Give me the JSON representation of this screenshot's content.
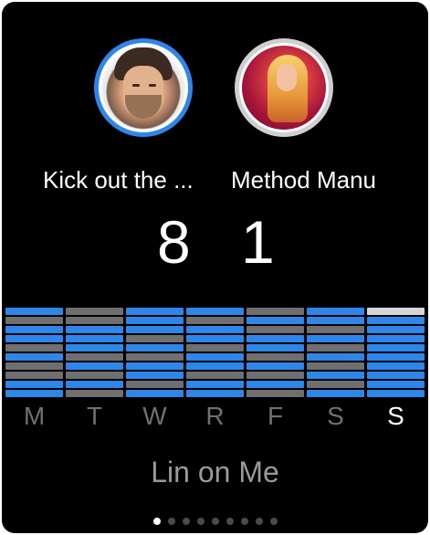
{
  "users": [
    {
      "name": "Kick out the ...",
      "count": "8",
      "ring_color": "#2f86ea"
    },
    {
      "name": "Method Manu",
      "count": "1",
      "ring_color": "#cfcfcf"
    }
  ],
  "colors": {
    "blue": "#2d86e8",
    "gray": "#6f6f6f",
    "light": "#d6d6d6",
    "background": "#000000"
  },
  "chart_data": {
    "type": "heatmap",
    "days": [
      "M",
      "T",
      "W",
      "R",
      "F",
      "S",
      "S"
    ],
    "active_day_index": 6,
    "legend": {
      "b": "blue",
      "g": "gray",
      "l": "light"
    },
    "columns": [
      [
        "b",
        "g",
        "b",
        "b",
        "g",
        "b",
        "g",
        "g",
        "b",
        "b"
      ],
      [
        "g",
        "g",
        "b",
        "b",
        "b",
        "g",
        "b",
        "g",
        "b",
        "g"
      ],
      [
        "b",
        "b",
        "b",
        "g",
        "b",
        "g",
        "b",
        "b",
        "g",
        "b"
      ],
      [
        "b",
        "g",
        "b",
        "b",
        "g",
        "b",
        "b",
        "g",
        "b",
        "b"
      ],
      [
        "g",
        "b",
        "g",
        "b",
        "b",
        "g",
        "b",
        "g",
        "b",
        "g"
      ],
      [
        "b",
        "b",
        "g",
        "b",
        "g",
        "b",
        "g",
        "b",
        "g",
        "b"
      ],
      [
        "l",
        "b",
        "b",
        "b",
        "b",
        "b",
        "b",
        "b",
        "b",
        "b"
      ]
    ]
  },
  "track": "Lin on Me",
  "pager": {
    "count": 9,
    "active": 0
  }
}
